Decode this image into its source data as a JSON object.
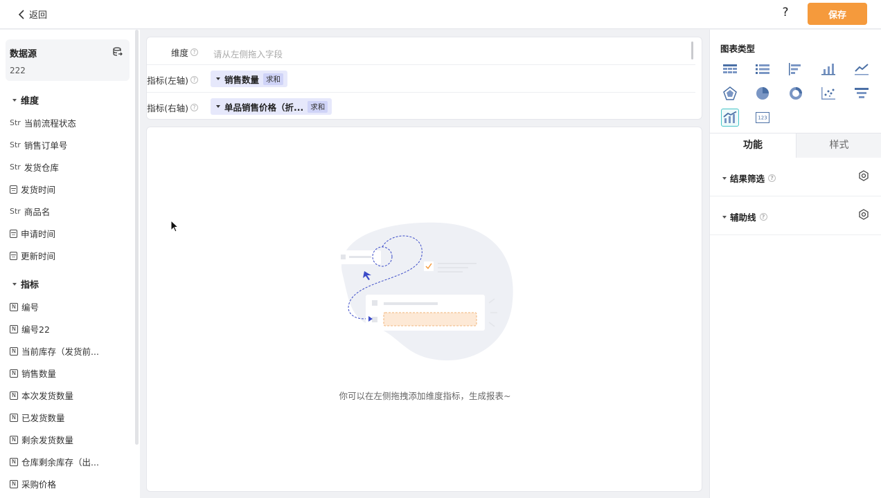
{
  "header": {
    "back_label": "返回",
    "help_label": "?",
    "save_label": "保存"
  },
  "datasource": {
    "title": "数据源",
    "value": "222"
  },
  "dimensions": {
    "title": "维度",
    "items": [
      {
        "type": "Str",
        "label": "当前流程状态"
      },
      {
        "type": "Str",
        "label": "销售订单号"
      },
      {
        "type": "Str",
        "label": "发货仓库"
      },
      {
        "type": "date",
        "label": "发货时间"
      },
      {
        "type": "Str",
        "label": "商品名"
      },
      {
        "type": "date",
        "label": "申请时间"
      },
      {
        "type": "date",
        "label": "更新时间"
      }
    ]
  },
  "metrics": {
    "title": "指标",
    "type_glyph": "N",
    "items": [
      {
        "label": "编号"
      },
      {
        "label": "编号22"
      },
      {
        "label": "当前库存（发货前..."
      },
      {
        "label": "销售数量"
      },
      {
        "label": "本次发货数量"
      },
      {
        "label": "已发货数量"
      },
      {
        "label": "剩余发货数量"
      },
      {
        "label": "仓库剩余库存（出..."
      },
      {
        "label": "采购价格"
      }
    ]
  },
  "config": {
    "dimension": {
      "label": "维度",
      "placeholder": "请从左侧拖入字段"
    },
    "left_axis": {
      "label": "指标(左轴)",
      "field": "销售数量",
      "agg": "求和"
    },
    "right_axis": {
      "label": "指标(右轴)",
      "field": "单品销售价格（折...",
      "agg": "求和"
    }
  },
  "canvas": {
    "empty_text": "你可以在左侧拖拽添加维度指标，生成报表~"
  },
  "chart_types": {
    "title": "图表类型",
    "items": [
      "table",
      "list",
      "bar-horizontal",
      "bar",
      "line",
      "radar",
      "pie",
      "donut",
      "scatter",
      "funnel",
      "combo",
      "number"
    ],
    "selected": "combo"
  },
  "tabs": {
    "function": "功能",
    "style": "样式"
  },
  "functions": [
    {
      "label": "结果筛选"
    },
    {
      "label": "辅助线"
    }
  ],
  "colors": {
    "accent": "#f59a3c",
    "chip": "#e6e8fb",
    "selected": "#44c4c8"
  }
}
